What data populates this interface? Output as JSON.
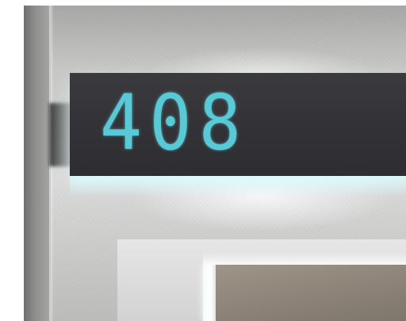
{
  "sign": {
    "room_number": "408"
  },
  "colors": {
    "digit_color": "#59c9d6",
    "plate_color": "#333337",
    "wall_color": "#d4d4d2"
  }
}
